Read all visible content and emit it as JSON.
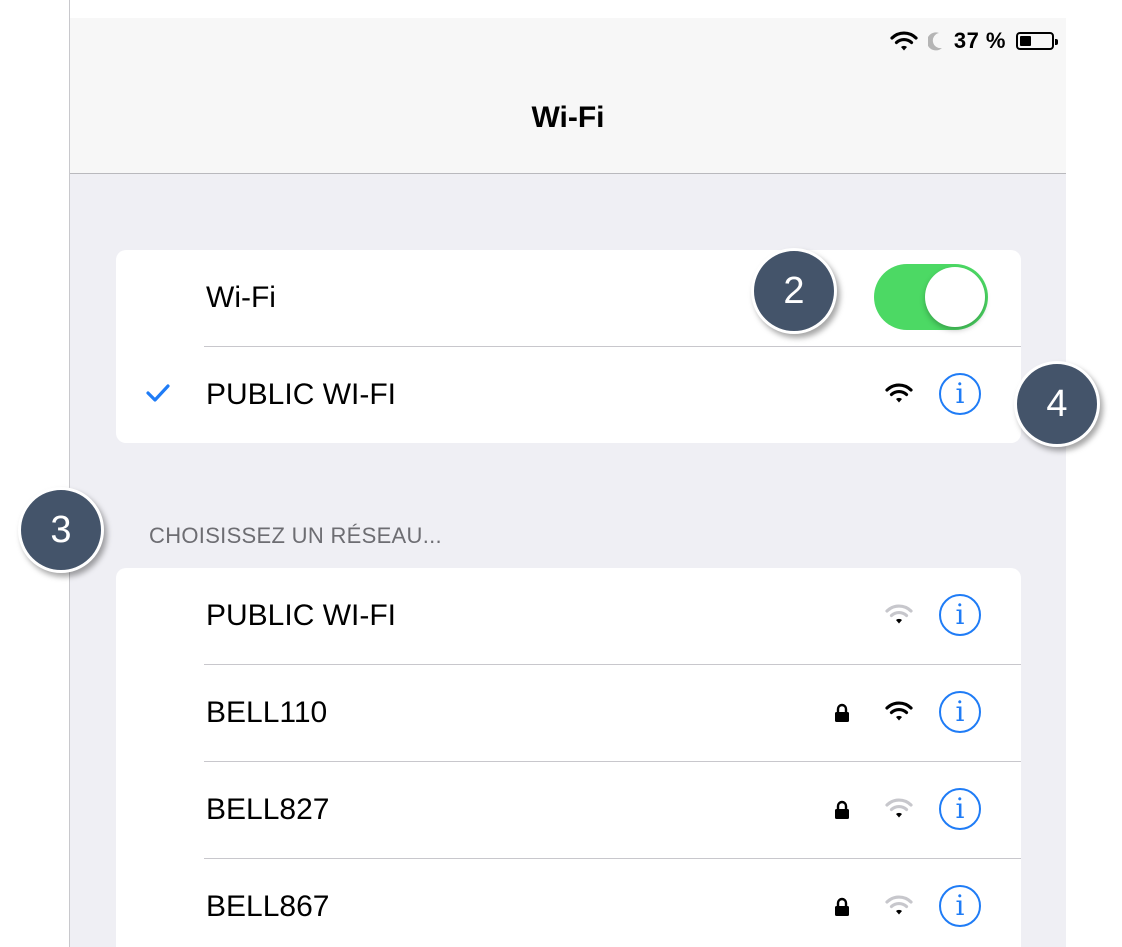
{
  "status_bar": {
    "battery_text": "37 %",
    "battery_level": 0.37,
    "icons": [
      "wifi-icon",
      "moon-icon",
      "battery-icon"
    ]
  },
  "nav": {
    "title": "Wi-Fi"
  },
  "wifi_toggle": {
    "label": "Wi-Fi",
    "on": true,
    "on_color": "#4cd964"
  },
  "connected_network": {
    "name": "PUBLIC WI-FI",
    "signal_strength": 3,
    "info_glyph": "i"
  },
  "section_header": "CHOISISSEZ UN RÉSEAU...",
  "networks": [
    {
      "name": "PUBLIC WI-FI",
      "locked": false,
      "signal_strength": 1,
      "info_glyph": "i"
    },
    {
      "name": "BELL110",
      "locked": true,
      "signal_strength": 3,
      "info_glyph": "i"
    },
    {
      "name": "BELL827",
      "locked": true,
      "signal_strength": 1,
      "info_glyph": "i"
    },
    {
      "name": "BELL867",
      "locked": true,
      "signal_strength": 1,
      "info_glyph": "i"
    }
  ],
  "callouts": {
    "toggle": "2",
    "section": "3",
    "info": "4"
  },
  "colors": {
    "accent": "#1f7cf6",
    "callout_bg": "#44546a",
    "background": "#efeff4"
  }
}
